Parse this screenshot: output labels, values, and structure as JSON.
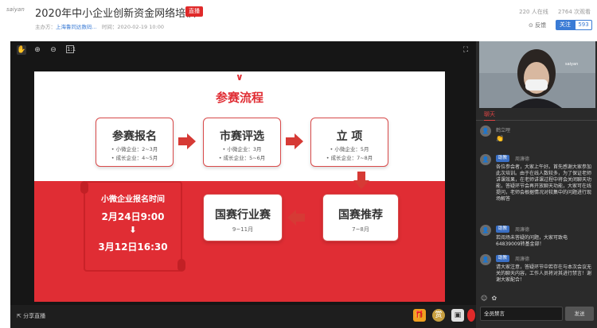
{
  "header": {
    "logo_text": "saiyan",
    "title": "2020年中小企业创新资金网络培训",
    "live_badge": "直播",
    "organizer_prefix": "主办方：",
    "organizer": "上海鲁同达数码...",
    "time_label": "时间：",
    "time": "2020-02-19 10:00",
    "online": "220 人在线",
    "views": "2764 次观看",
    "feedback": "反馈",
    "follow": "关注",
    "follow_count": "593"
  },
  "slide": {
    "title": "参赛流程",
    "steps": [
      {
        "title": "参赛报名",
        "lines": [
          "小微企业：2~3月",
          "成长企业：4~5月"
        ]
      },
      {
        "title": "市赛评选",
        "lines": [
          "小微企业：3月",
          "成长企业：5~6月"
        ]
      },
      {
        "title": "立    项",
        "lines": [
          "小微企业：5月",
          "成长企业：7~8月"
        ]
      },
      {
        "title": "国赛推荐",
        "sub": "7~8月"
      },
      {
        "title": "国赛行业赛",
        "sub": "9~11月"
      }
    ],
    "scroll": {
      "heading": "小微企业报名时间",
      "start": "2月24日9:00",
      "end": "3月12日16:30"
    }
  },
  "bottom": {
    "share": "分享直播"
  },
  "chat": {
    "tab": "聊天",
    "messages": [
      {
        "name": "鹤立哩",
        "role": "",
        "text": "👏"
      },
      {
        "name": "周濂德",
        "role": "助教",
        "text": "各位参会者，大家上午好。首先感谢大家参加此次培训。由于在线人数较多，为了保证老师讲课效果，在老师讲课过程中将会关闭聊天功能，答疑环节会再开放聊天功能，大家可在线提问，老师会根据情况对较集中的问题进行现场解答"
      },
      {
        "name": "周濂德",
        "role": "助教",
        "text": "若阅场未答疑的问题，大家可致电64839009转基金部！"
      },
      {
        "name": "周濂德",
        "role": "助教",
        "text": "请大家注意，答疑环节中若存在与本次会议无关的聊天内容，工作人员将对其进行禁言！谢谢大家配合！"
      }
    ],
    "input_value": "全员禁言",
    "send": "发送"
  }
}
